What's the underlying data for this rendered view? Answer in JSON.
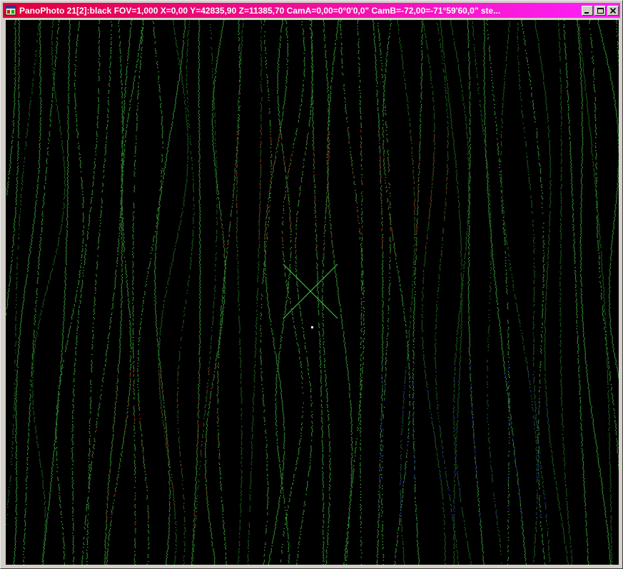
{
  "window": {
    "title": "PanoPhoto 21[2]:black FOV=1,000 X=0,00 Y=42835,90 Z=11385,70 CamA=0,00=0°0'0,0\" CamB=-72,00=-71°59'60,0\" ste...",
    "title_gradient": [
      "#e0003a",
      "#ff20ff"
    ],
    "icon": "app-window-icon",
    "controls": [
      "minimize-icon",
      "maximize-icon",
      "close-icon"
    ]
  },
  "viewport": {
    "background": "#000000",
    "crosshair_color": "#3ddc3d",
    "point_colors": {
      "primary": "#4cd84c",
      "secondary": "#2fa82f",
      "warm": "#c8553a",
      "cool": "#3a40c8"
    }
  }
}
